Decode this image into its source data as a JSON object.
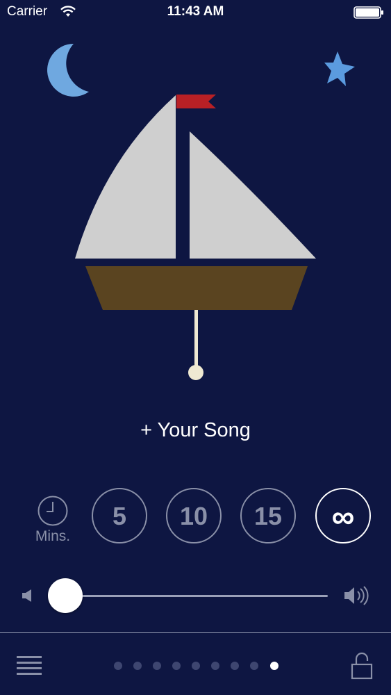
{
  "status_bar": {
    "carrier": "Carrier",
    "time": "11:43 AM"
  },
  "scene": {
    "icons": [
      "moon-icon",
      "star-icon",
      "sailboat-icon",
      "pendulum-icon"
    ],
    "colors": {
      "background": "#0e1642",
      "moon": "#6fa8e0",
      "star": "#5b9bdf",
      "sail": "#cfcfcf",
      "hull": "#5a4420",
      "flag": "#b82025",
      "pendulum": "#efe9d2"
    }
  },
  "song": {
    "label": "+ Your Song"
  },
  "timer": {
    "label": "Mins.",
    "options": [
      "5",
      "10",
      "15",
      "∞"
    ],
    "selected": "∞"
  },
  "volume": {
    "level": 0.0
  },
  "pager": {
    "total": 9,
    "current": 9
  },
  "toolbar": {
    "icons": [
      "menu-icon",
      "lock-icon"
    ]
  }
}
